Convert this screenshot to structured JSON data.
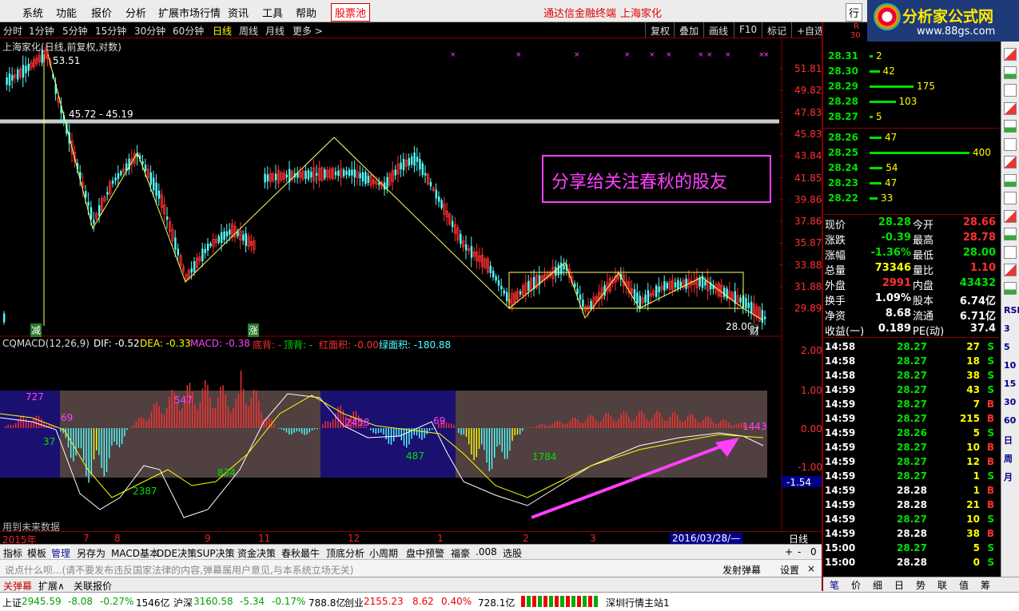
{
  "menu": {
    "items": [
      "系统",
      "功能",
      "报价",
      "分析",
      "扩展市场行情",
      "资讯",
      "工具",
      "帮助"
    ],
    "stock_pool": "股票池",
    "broker": "通达信金融终端",
    "stock_name": "上海家化",
    "partial": "行"
  },
  "logo": {
    "title": "分析家公式网",
    "url": "www.88gs.com"
  },
  "periods": {
    "items": [
      "分时",
      "1分钟",
      "5分钟",
      "15分钟",
      "30分钟",
      "60分钟",
      "日线",
      "周线",
      "月线",
      "更多 >"
    ],
    "active": "日线"
  },
  "toolbar": {
    "items": [
      "复权",
      "叠加",
      "画线",
      "F10",
      "标记",
      "+自选"
    ]
  },
  "chart": {
    "title": "上海家化(日线,前复权,对数)",
    "price_axis": [
      "51.81",
      "49.82",
      "47.83",
      "45.83",
      "43.84",
      "41.85",
      "39.86",
      "37.86",
      "35.87",
      "33.88",
      "31.88",
      "29.89"
    ],
    "high_label": "53.51",
    "range_label": "45.72 - 45.19",
    "low_label": "28.00",
    "marker_fin": "财",
    "marker_down": "减",
    "marker_up": "涨",
    "annotation": "分享给关注春秋的股友"
  },
  "macd": {
    "name": "CQMACD(12,26,9)",
    "dif": "DIF: -0.52",
    "dea": "DEA: -0.33",
    "macd": "MACD: -0.38",
    "bottom_div": "底背: -",
    "top_div": "顶背: -",
    "red_area": "红面积: -0.00",
    "green_area": "绿面积: -180.88",
    "axis": [
      "2.00",
      "1.00",
      "0.00",
      "-1.00"
    ],
    "current": "-1.54",
    "area_labels": [
      "727",
      "37",
      "69",
      "547",
      "2387",
      "834",
      "2458",
      "487",
      "69",
      "1784",
      "1443"
    ],
    "future_note": "用到未来数据"
  },
  "datebar": {
    "year": "2015年",
    "months": [
      "7",
      "8",
      "9",
      "11",
      "12",
      "1",
      "2",
      "3"
    ],
    "cursor": "2016/03/28/—"
  },
  "tabs": {
    "items": [
      "指标",
      "模板",
      "管理",
      "另存为",
      "MACD基本",
      "DDE决策",
      "SUP决策",
      "资金决策",
      "春秋最牛",
      "顶底分析",
      "小周期",
      "盘中预警",
      "福豪",
      ".008",
      "选股"
    ],
    "active": "管理",
    "right": [
      "日线",
      "+",
      "-",
      "0"
    ]
  },
  "message": {
    "placeholder": "说点什么呗...(请不要发布违反国家法律的内容,弹幕属用户意见,与本系统立场无关)",
    "send": "发射弹幕",
    "settings": "设置",
    "close": "×"
  },
  "bottom_tabs": [
    "关弹幕",
    "扩展∧",
    "关联报价"
  ],
  "status": {
    "sh_label": "上证",
    "sh_val": "2945.59",
    "sh_chg": "-8.08",
    "sh_pct": "-0.27%",
    "sh_amt": "1546亿",
    "hs_label": "沪深",
    "hs_val": "3160.58",
    "hs_chg": "-5.34",
    "hs_pct": "-0.17%",
    "hs_amt": "788.8亿",
    "cy_label": "创业",
    "cy_val": "2155.23",
    "cy_chg": "8.62",
    "cy_pct": "0.40%",
    "cy_amt": "728.1亿",
    "server": "深圳行情主站1"
  },
  "orderbook": {
    "asks": [
      {
        "p": "28.31",
        "v": "2",
        "w": 0.01
      },
      {
        "p": "28.30",
        "v": "42",
        "w": 0.1
      },
      {
        "p": "28.29",
        "v": "175",
        "w": 0.44
      },
      {
        "p": "28.28",
        "v": "103",
        "w": 0.26
      },
      {
        "p": "28.27",
        "v": "5",
        "w": 0.01
      }
    ],
    "bids": [
      {
        "p": "28.26",
        "v": "47",
        "w": 0.12
      },
      {
        "p": "28.25",
        "v": "400",
        "w": 1.0
      },
      {
        "p": "28.24",
        "v": "54",
        "w": 0.13
      },
      {
        "p": "28.23",
        "v": "47",
        "w": 0.12
      },
      {
        "p": "28.22",
        "v": "33",
        "w": 0.08
      }
    ]
  },
  "quote": [
    {
      "l1": "现价",
      "v1": "28.28",
      "c1": "#00e000",
      "l2": "今开",
      "v2": "28.66",
      "c2": "#ff3030"
    },
    {
      "l1": "涨跌",
      "v1": "-0.39",
      "c1": "#00e000",
      "l2": "最高",
      "v2": "28.78",
      "c2": "#ff3030"
    },
    {
      "l1": "涨幅",
      "v1": "-1.36%",
      "c1": "#00e000",
      "l2": "最低",
      "v2": "28.00",
      "c2": "#00e000"
    },
    {
      "l1": "总量",
      "v1": "73346",
      "c1": "#ffff00",
      "l2": "量比",
      "v2": "1.10",
      "c2": "#ff3030"
    },
    {
      "l1": "外盘",
      "v1": "2991",
      "c1": "#ff3030",
      "l2": "内盘",
      "v2": "43432",
      "c2": "#00e000"
    },
    {
      "l1": "换手",
      "v1": "1.09%",
      "c1": "#ffffff",
      "l2": "股本",
      "v2": "6.74亿",
      "c2": "#ffffff"
    },
    {
      "l1": "净资",
      "v1": "8.68",
      "c1": "#ffffff",
      "l2": "流通",
      "v2": "6.71亿",
      "c2": "#ffffff"
    },
    {
      "l1": "收益(一)",
      "v1": "0.189",
      "c1": "#ffffff",
      "l2": "PE(动)",
      "v2": "37.4",
      "c2": "#ffffff"
    }
  ],
  "trades": [
    {
      "t": "14:58",
      "p": "28.27",
      "v": "27",
      "s": "S"
    },
    {
      "t": "14:58",
      "p": "28.27",
      "v": "18",
      "s": "S"
    },
    {
      "t": "14:58",
      "p": "28.27",
      "v": "38",
      "s": "S"
    },
    {
      "t": "14:59",
      "p": "28.27",
      "v": "43",
      "s": "S"
    },
    {
      "t": "14:59",
      "p": "28.27",
      "v": "7",
      "s": "B"
    },
    {
      "t": "14:59",
      "p": "28.27",
      "v": "215",
      "s": "B"
    },
    {
      "t": "14:59",
      "p": "28.26",
      "v": "5",
      "s": "S"
    },
    {
      "t": "14:59",
      "p": "28.27",
      "v": "10",
      "s": "B"
    },
    {
      "t": "14:59",
      "p": "28.27",
      "v": "12",
      "s": "B"
    },
    {
      "t": "14:59",
      "p": "28.27",
      "v": "1",
      "s": "S"
    },
    {
      "t": "14:59",
      "p": "28.28",
      "v": "1",
      "s": "B"
    },
    {
      "t": "14:59",
      "p": "28.28",
      "v": "21",
      "s": "B"
    },
    {
      "t": "14:59",
      "p": "28.27",
      "v": "10",
      "s": "S"
    },
    {
      "t": "14:59",
      "p": "28.28",
      "v": "38",
      "s": "B"
    },
    {
      "t": "15:00",
      "p": "28.27",
      "v": "5",
      "s": "S"
    },
    {
      "t": "15:00",
      "p": "28.28",
      "v": "0",
      "s": "S"
    }
  ],
  "right_tabs": [
    "笔",
    "价",
    "细",
    "日",
    "势",
    "联",
    "值",
    "筹"
  ],
  "side_labels": [
    "RSI",
    "3",
    "5",
    "10",
    "15",
    "30",
    "60",
    "日",
    "周",
    "月"
  ],
  "colors": {
    "up": "#ff3030",
    "down": "#54ffff",
    "macd_pos": "#ff3030",
    "macd_neg": "#54ffff",
    "dif": "#ffffff",
    "dea": "#ffff00",
    "arrow": "#ff40ff"
  }
}
